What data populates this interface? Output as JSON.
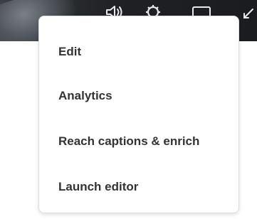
{
  "menu": {
    "items": [
      {
        "label": "Edit"
      },
      {
        "label": "Analytics"
      },
      {
        "label": "Reach captions & enrich"
      },
      {
        "label": "Launch editor"
      }
    ]
  },
  "player_controls": {
    "icons": [
      "volume-icon",
      "settings-icon",
      "fullscreen-icon",
      "expand-icon"
    ],
    "icon_color": "#e9eaec",
    "bar_color": "#1f2125"
  }
}
